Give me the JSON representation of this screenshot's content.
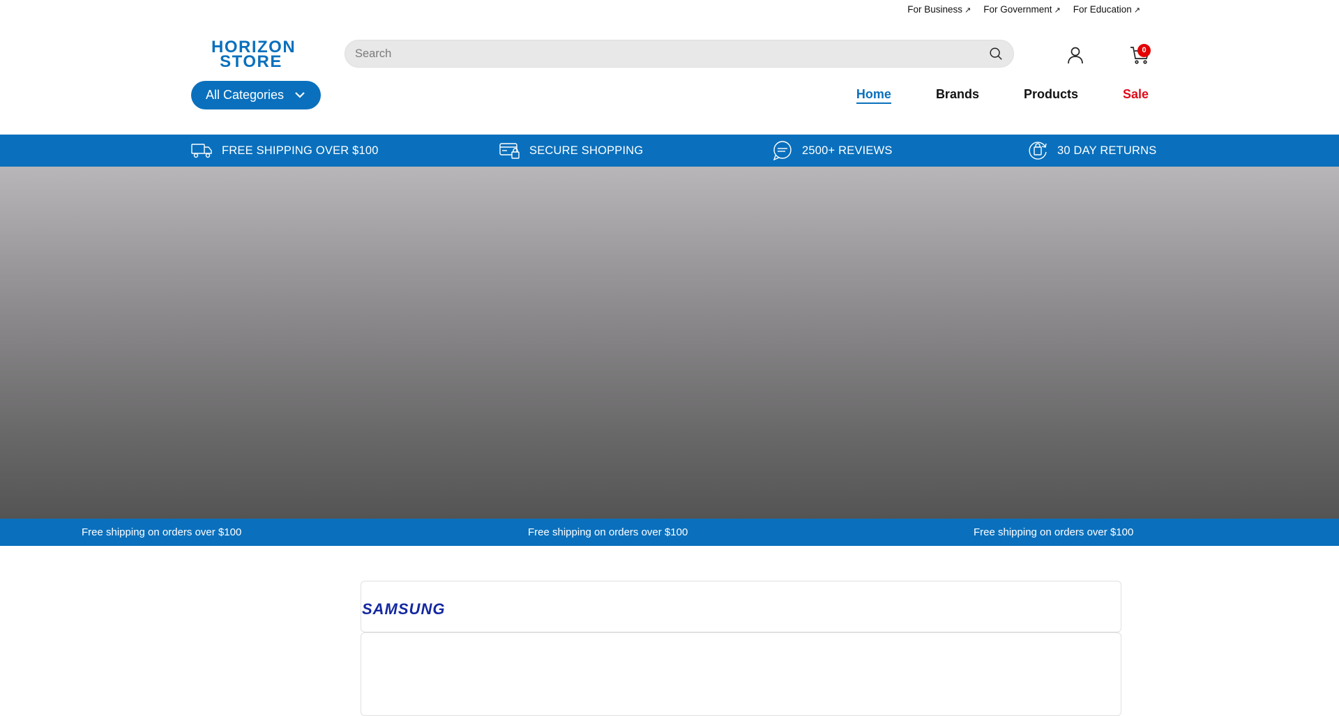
{
  "top_links": [
    {
      "label": "For Business",
      "arrow": "↗"
    },
    {
      "label": "For Government",
      "arrow": "↗"
    },
    {
      "label": "For Education",
      "arrow": "↗"
    }
  ],
  "logo": {
    "line1": "HORIZON",
    "line2": "STORE"
  },
  "search": {
    "placeholder": "Search",
    "value": ""
  },
  "cart": {
    "count": "0"
  },
  "categories": {
    "label": "All Categories"
  },
  "nav": {
    "home": "Home",
    "brands": "Brands",
    "products": "Products",
    "sale": "Sale"
  },
  "benefits": [
    {
      "label": "FREE SHIPPING OVER $100",
      "icon": "truck-icon"
    },
    {
      "label": "SECURE SHOPPING",
      "icon": "secure-card-icon"
    },
    {
      "label": "2500+ REVIEWS",
      "icon": "chat-bubble-icon"
    },
    {
      "label": "30 DAY RETURNS",
      "icon": "returns-bag-icon"
    }
  ],
  "ticker": [
    "Free shipping on orders over $100",
    "Free shipping on orders over $100",
    "Free shipping on orders over $100"
  ],
  "brand": {
    "name": "SAMSUNG"
  },
  "colors": {
    "accent": "#0a70bd",
    "sale": "#e00a1a",
    "badge": "#e40000"
  }
}
